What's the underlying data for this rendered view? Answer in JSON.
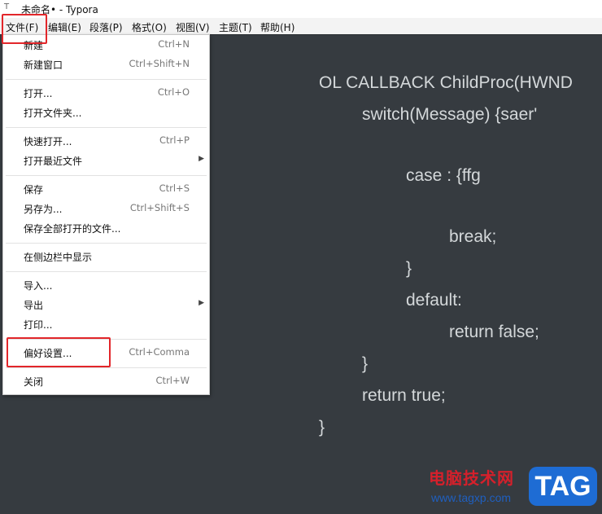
{
  "window": {
    "title": "未命名• - Typora",
    "icon": "typora-icon"
  },
  "menubar": [
    {
      "id": "file",
      "label": "文件(F)"
    },
    {
      "id": "edit",
      "label": "编辑(E)"
    },
    {
      "id": "paragraph",
      "label": "段落(P)"
    },
    {
      "id": "format",
      "label": "格式(O)"
    },
    {
      "id": "view",
      "label": "视图(V)"
    },
    {
      "id": "theme",
      "label": "主题(T)"
    },
    {
      "id": "help",
      "label": "帮助(H)"
    }
  ],
  "file_menu": {
    "items": [
      {
        "label": "新建",
        "shortcut": "Ctrl+N"
      },
      {
        "label": "新建窗口",
        "shortcut": "Ctrl+Shift+N"
      },
      {
        "label": "打开...",
        "shortcut": "Ctrl+O"
      },
      {
        "label": "打开文件夹...",
        "shortcut": ""
      },
      {
        "label": "快速打开...",
        "shortcut": "Ctrl+P"
      },
      {
        "label": "打开最近文件",
        "shortcut": "",
        "submenu": true
      },
      {
        "label": "保存",
        "shortcut": "Ctrl+S"
      },
      {
        "label": "另存为...",
        "shortcut": "Ctrl+Shift+S"
      },
      {
        "label": "保存全部打开的文件...",
        "shortcut": ""
      },
      {
        "label": "在侧边栏中显示",
        "shortcut": ""
      },
      {
        "label": "导入...",
        "shortcut": ""
      },
      {
        "label": "导出",
        "shortcut": "",
        "submenu": true
      },
      {
        "label": "打印...",
        "shortcut": ""
      },
      {
        "label": "偏好设置...",
        "shortcut": "Ctrl+Comma"
      },
      {
        "label": "关闭",
        "shortcut": "Ctrl+W"
      }
    ]
  },
  "editor": {
    "lines": [
      "OL CALLBACK ChildProc(HWND",
      "switch(Message) {saer'",
      "case : {ffg",
      "break;",
      "}",
      "default:",
      "return false;",
      "}",
      "return true;",
      "}"
    ]
  },
  "watermark": {
    "site_name": "电脑技术网",
    "url": "www.tagxp.com",
    "tag": "TAG"
  },
  "colors": {
    "editor_bg": "#363b40",
    "code_text": "#d4d8da",
    "highlight_border": "#e2262a",
    "watermark_red": "#d5202b",
    "watermark_blue": "#1e6cd4"
  }
}
